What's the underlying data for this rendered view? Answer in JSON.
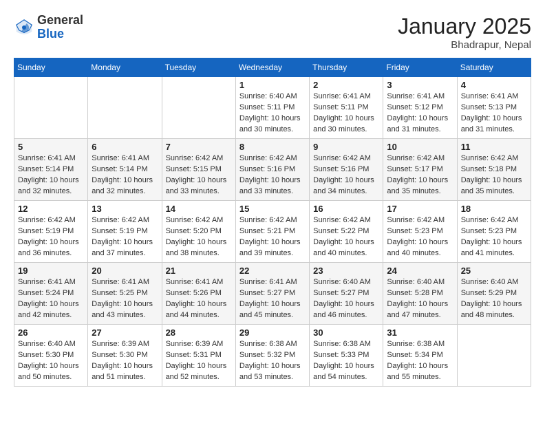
{
  "header": {
    "logo_general": "General",
    "logo_blue": "Blue",
    "month_year": "January 2025",
    "location": "Bhadrapur, Nepal"
  },
  "weekdays": [
    "Sunday",
    "Monday",
    "Tuesday",
    "Wednesday",
    "Thursday",
    "Friday",
    "Saturday"
  ],
  "weeks": [
    [
      {
        "day": "",
        "info": ""
      },
      {
        "day": "",
        "info": ""
      },
      {
        "day": "",
        "info": ""
      },
      {
        "day": "1",
        "info": "Sunrise: 6:40 AM\nSunset: 5:11 PM\nDaylight: 10 hours\nand 30 minutes."
      },
      {
        "day": "2",
        "info": "Sunrise: 6:41 AM\nSunset: 5:11 PM\nDaylight: 10 hours\nand 30 minutes."
      },
      {
        "day": "3",
        "info": "Sunrise: 6:41 AM\nSunset: 5:12 PM\nDaylight: 10 hours\nand 31 minutes."
      },
      {
        "day": "4",
        "info": "Sunrise: 6:41 AM\nSunset: 5:13 PM\nDaylight: 10 hours\nand 31 minutes."
      }
    ],
    [
      {
        "day": "5",
        "info": "Sunrise: 6:41 AM\nSunset: 5:14 PM\nDaylight: 10 hours\nand 32 minutes."
      },
      {
        "day": "6",
        "info": "Sunrise: 6:41 AM\nSunset: 5:14 PM\nDaylight: 10 hours\nand 32 minutes."
      },
      {
        "day": "7",
        "info": "Sunrise: 6:42 AM\nSunset: 5:15 PM\nDaylight: 10 hours\nand 33 minutes."
      },
      {
        "day": "8",
        "info": "Sunrise: 6:42 AM\nSunset: 5:16 PM\nDaylight: 10 hours\nand 33 minutes."
      },
      {
        "day": "9",
        "info": "Sunrise: 6:42 AM\nSunset: 5:16 PM\nDaylight: 10 hours\nand 34 minutes."
      },
      {
        "day": "10",
        "info": "Sunrise: 6:42 AM\nSunset: 5:17 PM\nDaylight: 10 hours\nand 35 minutes."
      },
      {
        "day": "11",
        "info": "Sunrise: 6:42 AM\nSunset: 5:18 PM\nDaylight: 10 hours\nand 35 minutes."
      }
    ],
    [
      {
        "day": "12",
        "info": "Sunrise: 6:42 AM\nSunset: 5:19 PM\nDaylight: 10 hours\nand 36 minutes."
      },
      {
        "day": "13",
        "info": "Sunrise: 6:42 AM\nSunset: 5:19 PM\nDaylight: 10 hours\nand 37 minutes."
      },
      {
        "day": "14",
        "info": "Sunrise: 6:42 AM\nSunset: 5:20 PM\nDaylight: 10 hours\nand 38 minutes."
      },
      {
        "day": "15",
        "info": "Sunrise: 6:42 AM\nSunset: 5:21 PM\nDaylight: 10 hours\nand 39 minutes."
      },
      {
        "day": "16",
        "info": "Sunrise: 6:42 AM\nSunset: 5:22 PM\nDaylight: 10 hours\nand 40 minutes."
      },
      {
        "day": "17",
        "info": "Sunrise: 6:42 AM\nSunset: 5:23 PM\nDaylight: 10 hours\nand 40 minutes."
      },
      {
        "day": "18",
        "info": "Sunrise: 6:42 AM\nSunset: 5:23 PM\nDaylight: 10 hours\nand 41 minutes."
      }
    ],
    [
      {
        "day": "19",
        "info": "Sunrise: 6:41 AM\nSunset: 5:24 PM\nDaylight: 10 hours\nand 42 minutes."
      },
      {
        "day": "20",
        "info": "Sunrise: 6:41 AM\nSunset: 5:25 PM\nDaylight: 10 hours\nand 43 minutes."
      },
      {
        "day": "21",
        "info": "Sunrise: 6:41 AM\nSunset: 5:26 PM\nDaylight: 10 hours\nand 44 minutes."
      },
      {
        "day": "22",
        "info": "Sunrise: 6:41 AM\nSunset: 5:27 PM\nDaylight: 10 hours\nand 45 minutes."
      },
      {
        "day": "23",
        "info": "Sunrise: 6:40 AM\nSunset: 5:27 PM\nDaylight: 10 hours\nand 46 minutes."
      },
      {
        "day": "24",
        "info": "Sunrise: 6:40 AM\nSunset: 5:28 PM\nDaylight: 10 hours\nand 47 minutes."
      },
      {
        "day": "25",
        "info": "Sunrise: 6:40 AM\nSunset: 5:29 PM\nDaylight: 10 hours\nand 48 minutes."
      }
    ],
    [
      {
        "day": "26",
        "info": "Sunrise: 6:40 AM\nSunset: 5:30 PM\nDaylight: 10 hours\nand 50 minutes."
      },
      {
        "day": "27",
        "info": "Sunrise: 6:39 AM\nSunset: 5:30 PM\nDaylight: 10 hours\nand 51 minutes."
      },
      {
        "day": "28",
        "info": "Sunrise: 6:39 AM\nSunset: 5:31 PM\nDaylight: 10 hours\nand 52 minutes."
      },
      {
        "day": "29",
        "info": "Sunrise: 6:38 AM\nSunset: 5:32 PM\nDaylight: 10 hours\nand 53 minutes."
      },
      {
        "day": "30",
        "info": "Sunrise: 6:38 AM\nSunset: 5:33 PM\nDaylight: 10 hours\nand 54 minutes."
      },
      {
        "day": "31",
        "info": "Sunrise: 6:38 AM\nSunset: 5:34 PM\nDaylight: 10 hours\nand 55 minutes."
      },
      {
        "day": "",
        "info": ""
      }
    ]
  ]
}
